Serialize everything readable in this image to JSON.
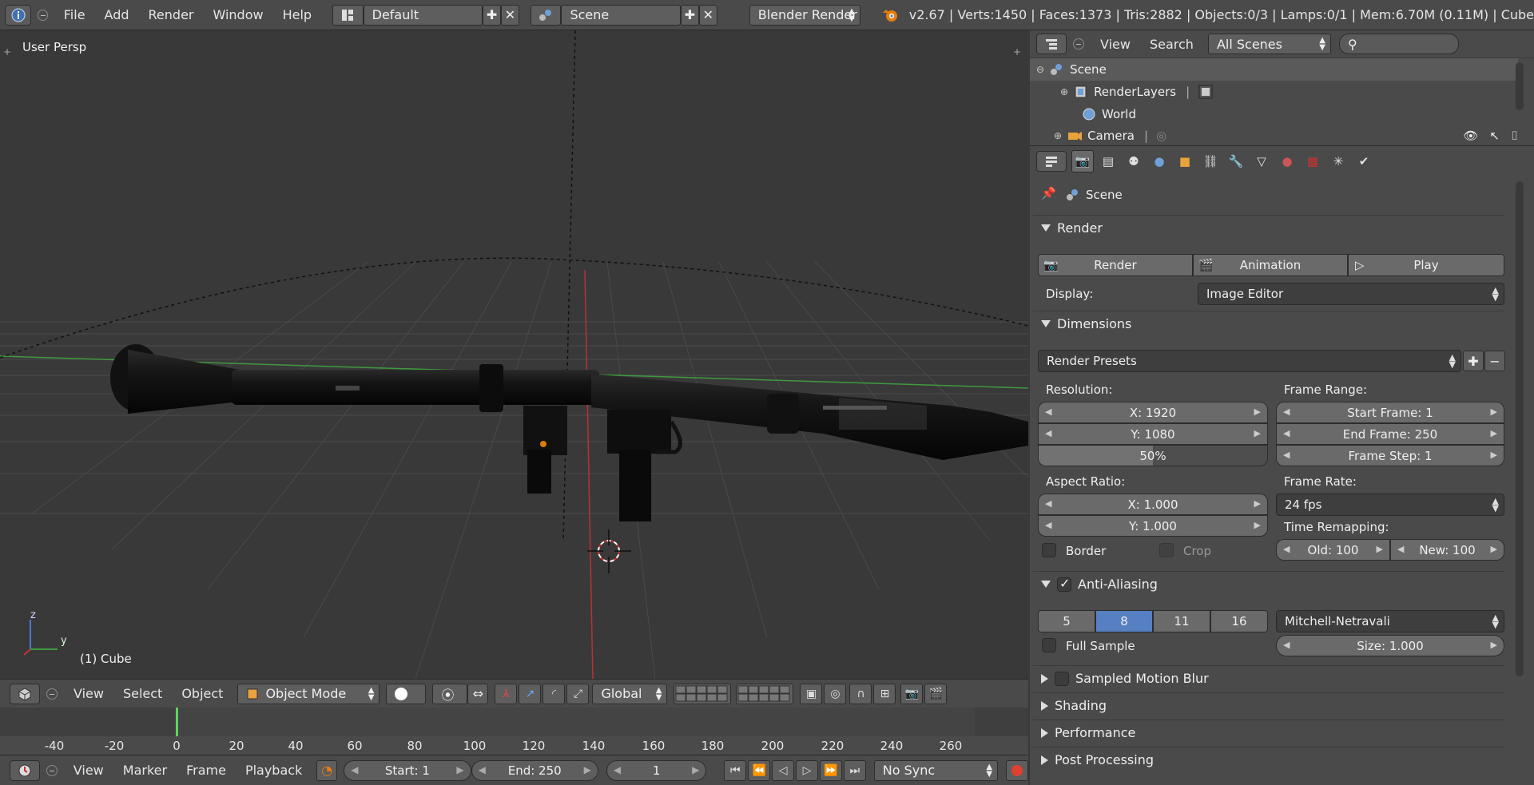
{
  "topbar": {
    "menus": [
      "File",
      "Add",
      "Render",
      "Window",
      "Help"
    ],
    "screen_layout": "Default",
    "scene": "Scene",
    "render_engine": "Blender Render",
    "stats": "v2.67 | Verts:1450 | Faces:1373 | Tris:2882 | Objects:0/3 | Lamps:0/1 | Mem:6.70M (0.11M) | Cube"
  },
  "viewport": {
    "view_label": "User Persp",
    "object_label": "(1) Cube",
    "axis_x": "y",
    "axis_z": "z"
  },
  "viewheader": {
    "menus": [
      "View",
      "Select",
      "Object"
    ],
    "mode": "Object Mode",
    "orientation": "Global"
  },
  "timeline": {
    "ticks": [
      "-40",
      "-20",
      "0",
      "20",
      "40",
      "60",
      "80",
      "100",
      "120",
      "140",
      "160",
      "180",
      "200",
      "220",
      "240",
      "260"
    ],
    "menus": [
      "View",
      "Marker",
      "Frame",
      "Playback"
    ],
    "start": "Start: 1",
    "end": "End: 250",
    "current": "1",
    "sync": "No Sync"
  },
  "outliner": {
    "menus": [
      "View",
      "Search"
    ],
    "filter": "All Scenes",
    "rows": [
      "Scene",
      "RenderLayers",
      "World",
      "Camera"
    ]
  },
  "properties": {
    "context": "Scene",
    "render_panel": {
      "title": "Render",
      "render_btn": "Render",
      "animation_btn": "Animation",
      "play_btn": "Play",
      "display_label": "Display:",
      "display_value": "Image Editor"
    },
    "dimensions": {
      "title": "Dimensions",
      "presets": "Render Presets",
      "resolution_label": "Resolution:",
      "res_x": "X: 1920",
      "res_y": "Y: 1080",
      "res_pct": "50%",
      "res_pct_value": 0.5,
      "frame_range_label": "Frame Range:",
      "start_frame": "Start Frame: 1",
      "end_frame": "End Frame: 250",
      "frame_step": "Frame Step: 1",
      "aspect_label": "Aspect Ratio:",
      "aspect_x": "X: 1.000",
      "aspect_y": "Y: 1.000",
      "frame_rate_label": "Frame Rate:",
      "frame_rate": "24 fps",
      "time_remap_label": "Time Remapping:",
      "old": "Old: 100",
      "new": "New: 100",
      "border": "Border",
      "crop": "Crop"
    },
    "antialiasing": {
      "title": "Anti-Aliasing",
      "samples": [
        "5",
        "8",
        "11",
        "16"
      ],
      "selected": "8",
      "filter": "Mitchell-Netravali",
      "full_sample": "Full Sample",
      "size": "Size: 1.000"
    },
    "collapsed_panels": [
      "Sampled Motion Blur",
      "Shading",
      "Performance",
      "Post Processing"
    ]
  },
  "colors": {
    "accent_blue": "#5680c2",
    "grid_red": "#b83232",
    "grid_green": "#3f9a3f",
    "timeline_current": "#5fd35f"
  }
}
